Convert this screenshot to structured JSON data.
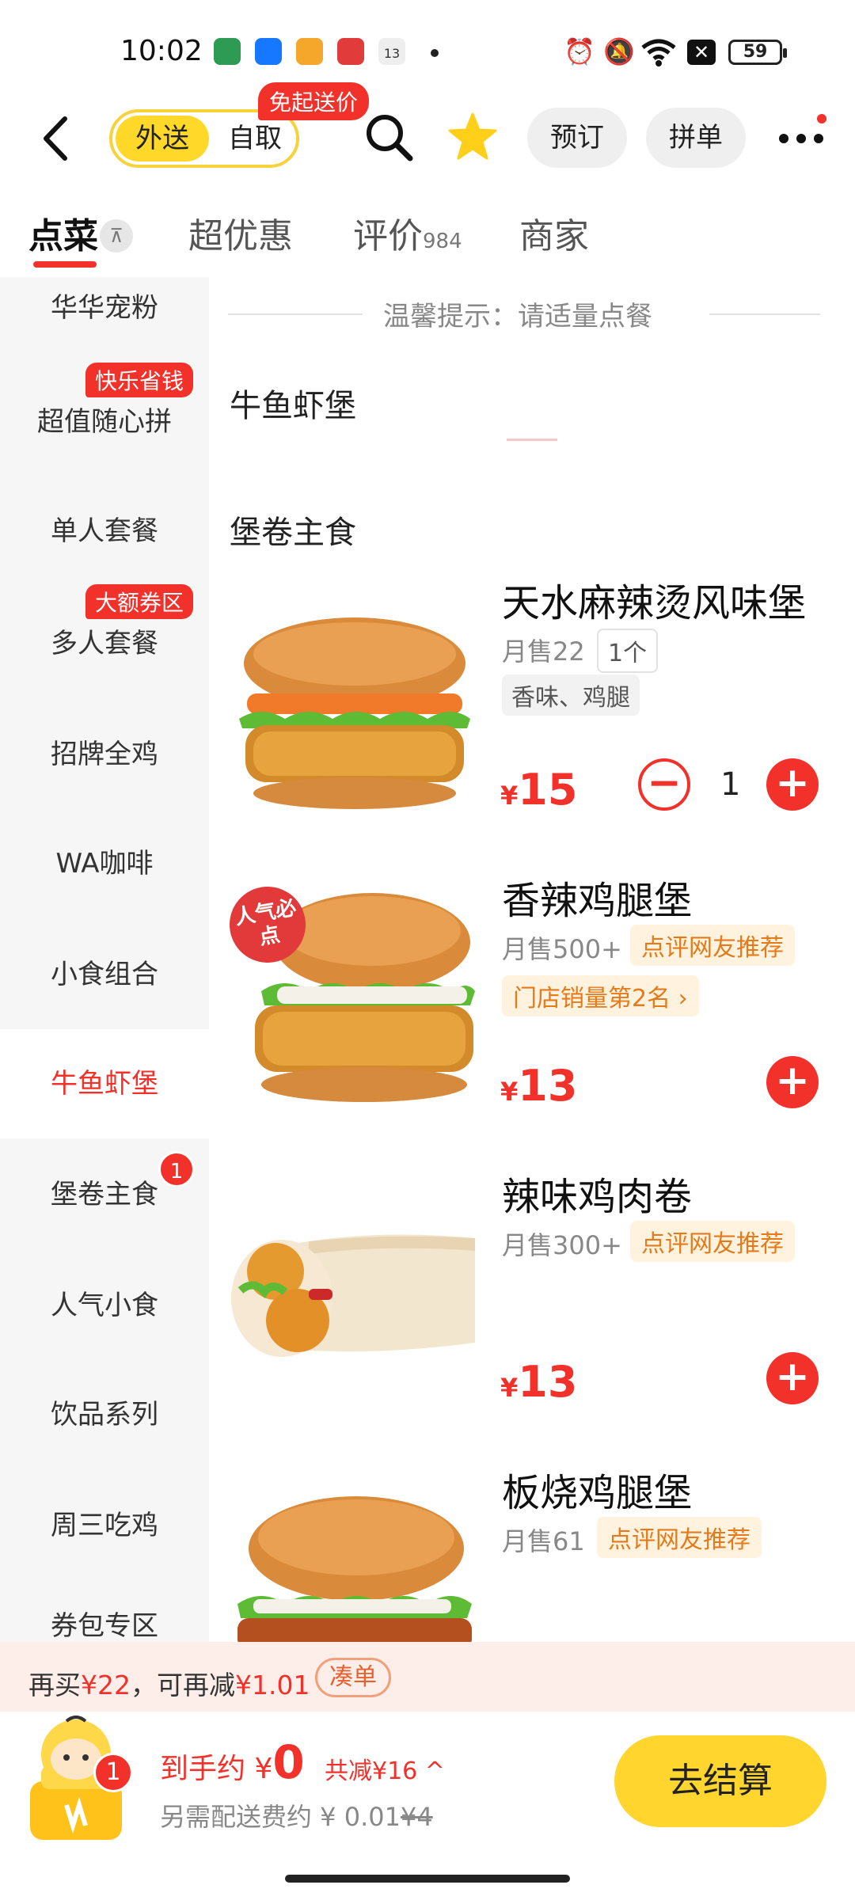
{
  "status_bar": {
    "time": "10:02",
    "battery": "59",
    "notif_date": "13"
  },
  "header": {
    "delivery_label": "外送",
    "pickup_label": "自取",
    "free_badge": "免起送价",
    "reserve_label": "预订",
    "group_order_label": "拼单"
  },
  "tabs": [
    {
      "label": "点菜",
      "count": ""
    },
    {
      "label": "超优惠",
      "count": ""
    },
    {
      "label": "评价",
      "count": "984"
    },
    {
      "label": "商家",
      "count": ""
    }
  ],
  "sidebar": {
    "items": [
      {
        "label": "华华宠粉",
        "tag": ""
      },
      {
        "label": "超值随心拼",
        "tag": "快乐省钱"
      },
      {
        "label": "单人套餐",
        "tag": ""
      },
      {
        "label": "多人套餐",
        "tag": "大额券区"
      },
      {
        "label": "招牌全鸡",
        "tag": ""
      },
      {
        "label": "WA咖啡",
        "tag": ""
      },
      {
        "label": "小食组合",
        "tag": ""
      },
      {
        "label": "牛鱼虾堡",
        "tag": "",
        "active": true
      },
      {
        "label": "堡卷主食",
        "tag": "",
        "badge": "1"
      },
      {
        "label": "人气小食",
        "tag": ""
      },
      {
        "label": "饮品系列",
        "tag": ""
      },
      {
        "label": "周三吃鸡",
        "tag": ""
      },
      {
        "label": "券包专区",
        "tag": ""
      }
    ]
  },
  "content": {
    "tip": "温馨提示：请适量点餐",
    "section1": "牛鱼虾堡",
    "section2": "堡卷主食",
    "products": [
      {
        "name": "天水麻辣烫风味堡",
        "sold": "月售22",
        "tag1": "1个",
        "tag2": "香味、鸡腿",
        "currency": "¥",
        "price": "15",
        "qty": "1"
      },
      {
        "name": "香辣鸡腿堡",
        "sold": "月售500+",
        "tag1": "点评网友推荐",
        "tag2": "门店销量第2名 ›",
        "currency": "¥",
        "price": "13",
        "badge": "人气必点"
      },
      {
        "name": "辣味鸡肉卷",
        "sold": "月售300+",
        "tag1": "点评网友推荐",
        "currency": "¥",
        "price": "13"
      },
      {
        "name": "板烧鸡腿堡",
        "sold": "月售61",
        "tag1": "点评网友推荐"
      }
    ]
  },
  "promo": {
    "prefix": "再买",
    "amount": "¥22",
    "middle": "，可再减",
    "discount": "¥1.01",
    "button": "凑单"
  },
  "cart": {
    "badge": "1",
    "total_prefix": "到手约",
    "total_currency": "¥",
    "total_value": "0",
    "discount": "共减¥16 ^",
    "delivery_prefix": "另需配送费约 ¥ 0.01",
    "delivery_original": "¥4",
    "checkout": "去结算"
  },
  "colors": {
    "accent_red": "#f2312a",
    "brand_yellow": "#ffd82a"
  }
}
